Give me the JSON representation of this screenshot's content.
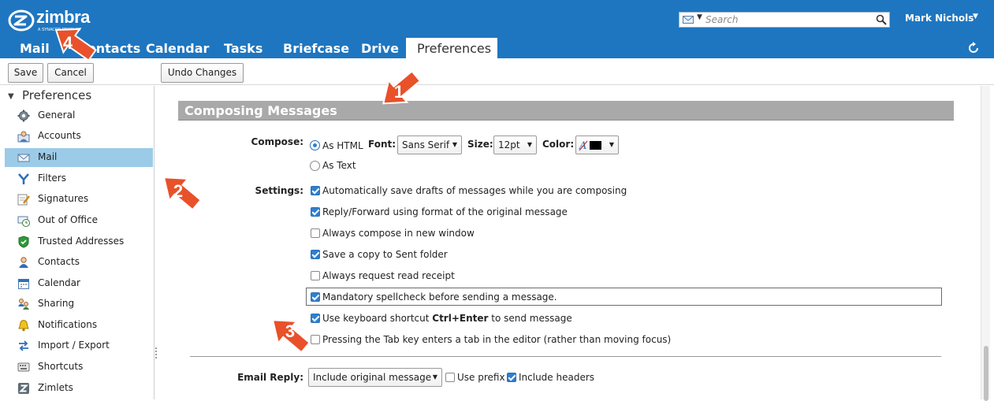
{
  "brand": {
    "name": "zimbra",
    "tagline": "A SYNACOR PRODUCT"
  },
  "search": {
    "placeholder": "Search"
  },
  "user": {
    "name": "Mark Nichols"
  },
  "tabs": [
    {
      "label": "Mail"
    },
    {
      "label": "Contacts"
    },
    {
      "label": "Calendar"
    },
    {
      "label": "Tasks"
    },
    {
      "label": "Briefcase"
    },
    {
      "label": "Drive"
    },
    {
      "label": "Preferences",
      "active": true
    }
  ],
  "toolbar": {
    "save": "Save",
    "cancel": "Cancel",
    "undo": "Undo Changes"
  },
  "sidebar": {
    "title": "Preferences",
    "items": [
      {
        "label": "General",
        "icon": "gear-icon"
      },
      {
        "label": "Accounts",
        "icon": "accounts-icon"
      },
      {
        "label": "Mail",
        "icon": "mail-icon",
        "selected": true
      },
      {
        "label": "Filters",
        "icon": "filter-icon"
      },
      {
        "label": "Signatures",
        "icon": "signature-icon"
      },
      {
        "label": "Out of Office",
        "icon": "out-of-office-icon"
      },
      {
        "label": "Trusted Addresses",
        "icon": "shield-icon"
      },
      {
        "label": "Contacts",
        "icon": "contacts-icon"
      },
      {
        "label": "Calendar",
        "icon": "calendar-icon"
      },
      {
        "label": "Sharing",
        "icon": "sharing-icon"
      },
      {
        "label": "Notifications",
        "icon": "bell-icon"
      },
      {
        "label": "Import / Export",
        "icon": "import-export-icon"
      },
      {
        "label": "Shortcuts",
        "icon": "keyboard-icon"
      },
      {
        "label": "Zimlets",
        "icon": "zimlets-icon"
      }
    ]
  },
  "main": {
    "section_title": "Composing Messages",
    "compose": {
      "label": "Compose:",
      "as_html": "As HTML",
      "as_text": "As Text",
      "font_label": "Font:",
      "font_value": "Sans Serif",
      "size_label": "Size:",
      "size_value": "12pt",
      "color_label": "Color:",
      "color_value": "#000000"
    },
    "settings": {
      "label": "Settings:",
      "options": [
        {
          "text": "Automatically save drafts of messages while you are composing",
          "checked": true
        },
        {
          "text": "Reply/Forward using format of the original message",
          "checked": true
        },
        {
          "text": "Always compose in new window",
          "checked": false
        },
        {
          "text": "Save a copy to Sent folder",
          "checked": true
        },
        {
          "text": "Always request read receipt",
          "checked": false
        },
        {
          "text": "Mandatory spellcheck before sending a message.",
          "checked": true
        },
        {
          "text_pre": "Use keyboard shortcut ",
          "text_bold": "Ctrl+Enter",
          "text_post": " to send message",
          "checked": true
        },
        {
          "text": "Pressing the Tab key enters a tab in the editor (rather than moving focus)",
          "checked": false
        }
      ]
    },
    "email_reply": {
      "label": "Email Reply:",
      "value": "Include original message",
      "use_prefix": "Use prefix",
      "use_prefix_checked": false,
      "include_headers": "Include headers",
      "include_headers_checked": true
    }
  },
  "callouts": {
    "one": "1",
    "two": "2",
    "three": "3",
    "four": "4",
    "color": "#e8512a"
  }
}
